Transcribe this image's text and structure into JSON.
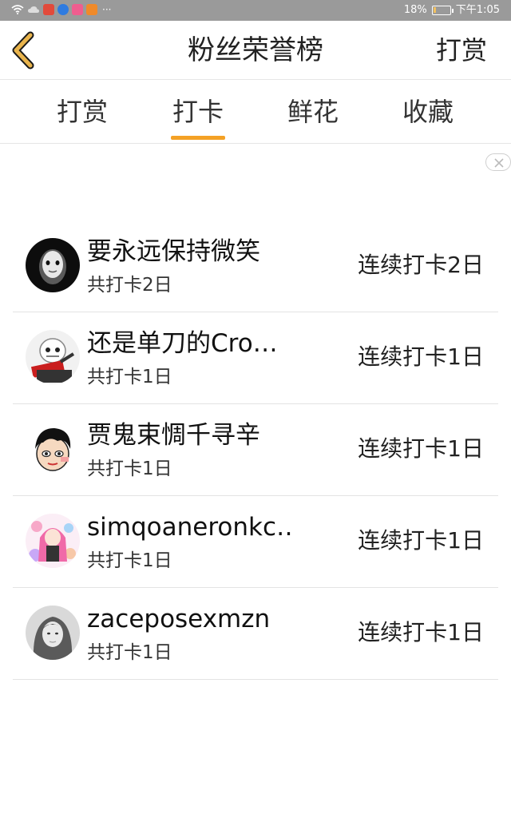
{
  "status_bar": {
    "battery": "18%",
    "battery_level": 0.18,
    "time": "下午1:05",
    "dots": "···",
    "icons": [
      "wifi-icon",
      "cloud-icon",
      "app-icon-red",
      "app-icon-blue",
      "app-icon-pink",
      "play-icon"
    ]
  },
  "header": {
    "title": "粉丝荣誉榜",
    "right_button": "打赏",
    "back_icon": "chevron-left-icon",
    "accent_color": "#e9b44c"
  },
  "tabs": [
    {
      "label": "打赏",
      "active": false
    },
    {
      "label": "打卡",
      "active": true
    },
    {
      "label": "鲜花",
      "active": false
    },
    {
      "label": "收藏",
      "active": false
    }
  ],
  "tab_indicator_color": "#f4a125",
  "close_icon": "close-icon",
  "list": [
    {
      "name": "要永远保持微笑",
      "total": "共打卡2日",
      "streak": "连续打卡2日",
      "avatar": "mask-avatar"
    },
    {
      "name": "还是单刀的Cro…",
      "total": "共打卡1日",
      "streak": "连续打卡1日",
      "avatar": "skeleton-avatar"
    },
    {
      "name": "贾鬼束惆千寻辛",
      "total": "共打卡1日",
      "streak": "连续打卡1日",
      "avatar": "cartoon-boy-avatar"
    },
    {
      "name": "simqoaneronkc…",
      "total": "共打卡1日",
      "streak": "连续打卡1日",
      "avatar": "anime-girl-avatar"
    },
    {
      "name": "zaceposexmzn",
      "total": "共打卡1日",
      "streak": "连续打卡1日",
      "avatar": "photo-girl-avatar"
    }
  ]
}
